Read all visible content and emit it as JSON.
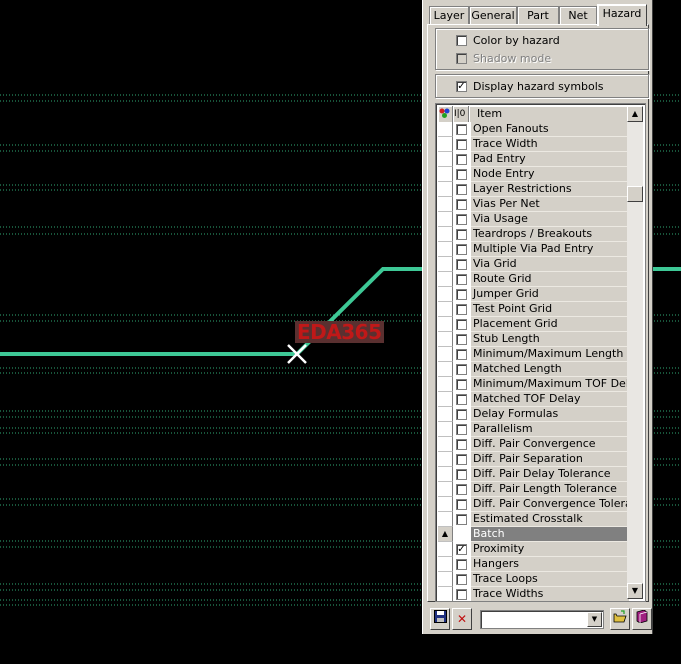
{
  "colors": {
    "background": "#000000",
    "trace": "#3ec896",
    "dotted_lines": "#2fa874",
    "cursor": "#ffffff",
    "watermark_text": "#c01818",
    "watermark_bg": "#5a3030",
    "panel_bg": "#d4d0c8"
  },
  "watermark": "EDA365",
  "tabs": [
    {
      "label": "Layer",
      "active": false
    },
    {
      "label": "General",
      "active": false
    },
    {
      "label": "Part",
      "active": false
    },
    {
      "label": "Net",
      "active": false
    },
    {
      "label": "Hazard",
      "active": true
    }
  ],
  "options": {
    "color_by_hazard": {
      "label": "Color by hazard",
      "checked": false
    },
    "shadow_mode": {
      "label": "Shadow mode",
      "checked": false,
      "disabled": true
    },
    "display_hazard_symbols": {
      "label": "Display hazard symbols",
      "checked": true
    }
  },
  "list": {
    "header": {
      "col_icon": "color-icon",
      "col_check": "I|0",
      "col_item": "Item"
    },
    "rows": [
      {
        "label": "Open Fanouts",
        "checked": false
      },
      {
        "label": "Trace Width",
        "checked": false
      },
      {
        "label": "Pad Entry",
        "checked": false
      },
      {
        "label": "Node Entry",
        "checked": false
      },
      {
        "label": "Layer Restrictions",
        "checked": false
      },
      {
        "label": "Vias Per Net",
        "checked": false
      },
      {
        "label": "Via Usage",
        "checked": false
      },
      {
        "label": "Teardrops / Breakouts",
        "checked": false
      },
      {
        "label": "Multiple Via Pad Entry",
        "checked": false
      },
      {
        "label": "Via Grid",
        "checked": false
      },
      {
        "label": "Route Grid",
        "checked": false
      },
      {
        "label": "Jumper Grid",
        "checked": false
      },
      {
        "label": "Test Point Grid",
        "checked": false
      },
      {
        "label": "Placement Grid",
        "checked": false
      },
      {
        "label": "Stub Length",
        "checked": false
      },
      {
        "label": "Minimum/Maximum Length",
        "checked": false
      },
      {
        "label": "Matched Length",
        "checked": false
      },
      {
        "label": "Minimum/Maximum TOF Delay",
        "checked": false
      },
      {
        "label": "Matched TOF Delay",
        "checked": false
      },
      {
        "label": "Delay Formulas",
        "checked": false
      },
      {
        "label": "Parallelism",
        "checked": false
      },
      {
        "label": "Diff. Pair Convergence",
        "checked": false
      },
      {
        "label": "Diff. Pair Separation",
        "checked": false
      },
      {
        "label": "Diff. Pair Delay Tolerance",
        "checked": false
      },
      {
        "label": "Diff. Pair Length Tolerance",
        "checked": false
      },
      {
        "label": "Diff. Pair Convergence Toleran...",
        "checked": false
      },
      {
        "label": "Estimated Crosstalk",
        "checked": false
      },
      {
        "label": "Batch",
        "group": true,
        "expanded": true
      },
      {
        "label": "Proximity",
        "checked": true
      },
      {
        "label": "Hangers",
        "checked": false
      },
      {
        "label": "Trace Loops",
        "checked": false
      },
      {
        "label": "Trace Widths",
        "checked": false
      }
    ]
  },
  "toolbar": {
    "save_icon": "save-icon",
    "delete_icon": "delete-icon",
    "combo_value": "",
    "open_icon": "open-folder-icon",
    "book_icon": "book-icon"
  }
}
